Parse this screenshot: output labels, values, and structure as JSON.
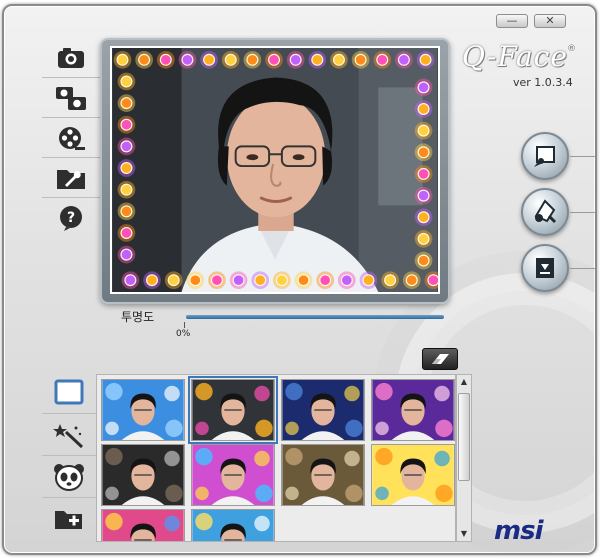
{
  "app": {
    "logo_text": "Q-Face",
    "logo_mark": "®",
    "version": "ver 1.0.3.4",
    "brand": "msi"
  },
  "window_controls": {
    "minimize_label": "—",
    "close_label": "✕"
  },
  "sidebar": {
    "items": [
      {
        "name": "camera-icon"
      },
      {
        "name": "dual-camera-icon"
      },
      {
        "name": "film-reel-icon"
      },
      {
        "name": "settings-folder-icon"
      },
      {
        "name": "help-icon"
      }
    ]
  },
  "preview": {
    "frame_theme": "glowing-lights-border"
  },
  "right_buttons": [
    {
      "name": "capture-photo-icon"
    },
    {
      "name": "record-icon"
    },
    {
      "name": "download-icon"
    }
  ],
  "opacity": {
    "label": "투명도",
    "value_label": "0%",
    "value": 0
  },
  "categories": [
    {
      "name": "frame-icon"
    },
    {
      "name": "magic-wand-icon"
    },
    {
      "name": "panda-face-icon"
    },
    {
      "name": "add-folder-icon"
    }
  ],
  "thumbnails": [
    {
      "theme": "blue-bubbles",
      "selected": false
    },
    {
      "theme": "glowing-lights",
      "selected": true
    },
    {
      "theme": "night-halloween",
      "selected": false
    },
    {
      "theme": "purple-heart",
      "selected": false
    },
    {
      "theme": "microphone-stage",
      "selected": false
    },
    {
      "theme": "colorful-stage",
      "selected": false
    },
    {
      "theme": "oval-vignette",
      "selected": false
    },
    {
      "theme": "sunflower",
      "selected": false
    },
    {
      "theme": "partial-1",
      "selected": false
    },
    {
      "theme": "partial-2",
      "selected": false
    }
  ],
  "colors": {
    "accent_blue": "#3f78b8",
    "brand_blue": "#1a2b86",
    "slider_blue": "#2f6a9c"
  }
}
